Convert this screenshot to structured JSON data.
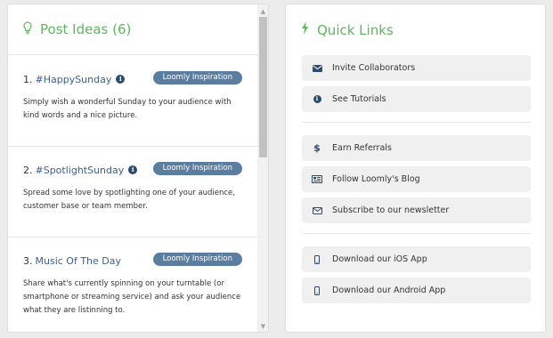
{
  "post_ideas": {
    "title": "Post Ideas (6)",
    "items": [
      {
        "number": "1.",
        "title": "#HappySunday",
        "badge": "Loomly Inspiration",
        "description": "Simply wish a wonderful Sunday to your audience with kind words and a nice picture."
      },
      {
        "number": "2.",
        "title": "#SpotlightSunday",
        "badge": "Loomly Inspiration",
        "description": "Spread some love by spotlighting one of your audience, customer base or team member."
      },
      {
        "number": "3.",
        "title": "Music Of The Day",
        "badge": "Loomly Inspiration",
        "description": "Share what's currently spinning on your turntable (or smartphone or streaming service) and ask your audience what they are listinning to."
      }
    ]
  },
  "quick_links": {
    "title": "Quick Links",
    "groups": [
      [
        {
          "label": "Invite Collaborators",
          "icon": "envelope-icon"
        },
        {
          "label": "See Tutorials",
          "icon": "info-circle-icon"
        }
      ],
      [
        {
          "label": "Earn Referrals",
          "icon": "dollar-icon"
        },
        {
          "label": "Follow Loomly's Blog",
          "icon": "newspaper-icon"
        },
        {
          "label": "Subscribe to our newsletter",
          "icon": "envelope-outline-icon"
        }
      ],
      [
        {
          "label": "Download our iOS App",
          "icon": "mobile-icon"
        },
        {
          "label": "Download our Android App",
          "icon": "mobile-icon"
        }
      ]
    ]
  },
  "colors": {
    "accent_green": "#5cb85c",
    "link_blue": "#3a5f8f",
    "badge_blue": "#5b7ea0"
  }
}
